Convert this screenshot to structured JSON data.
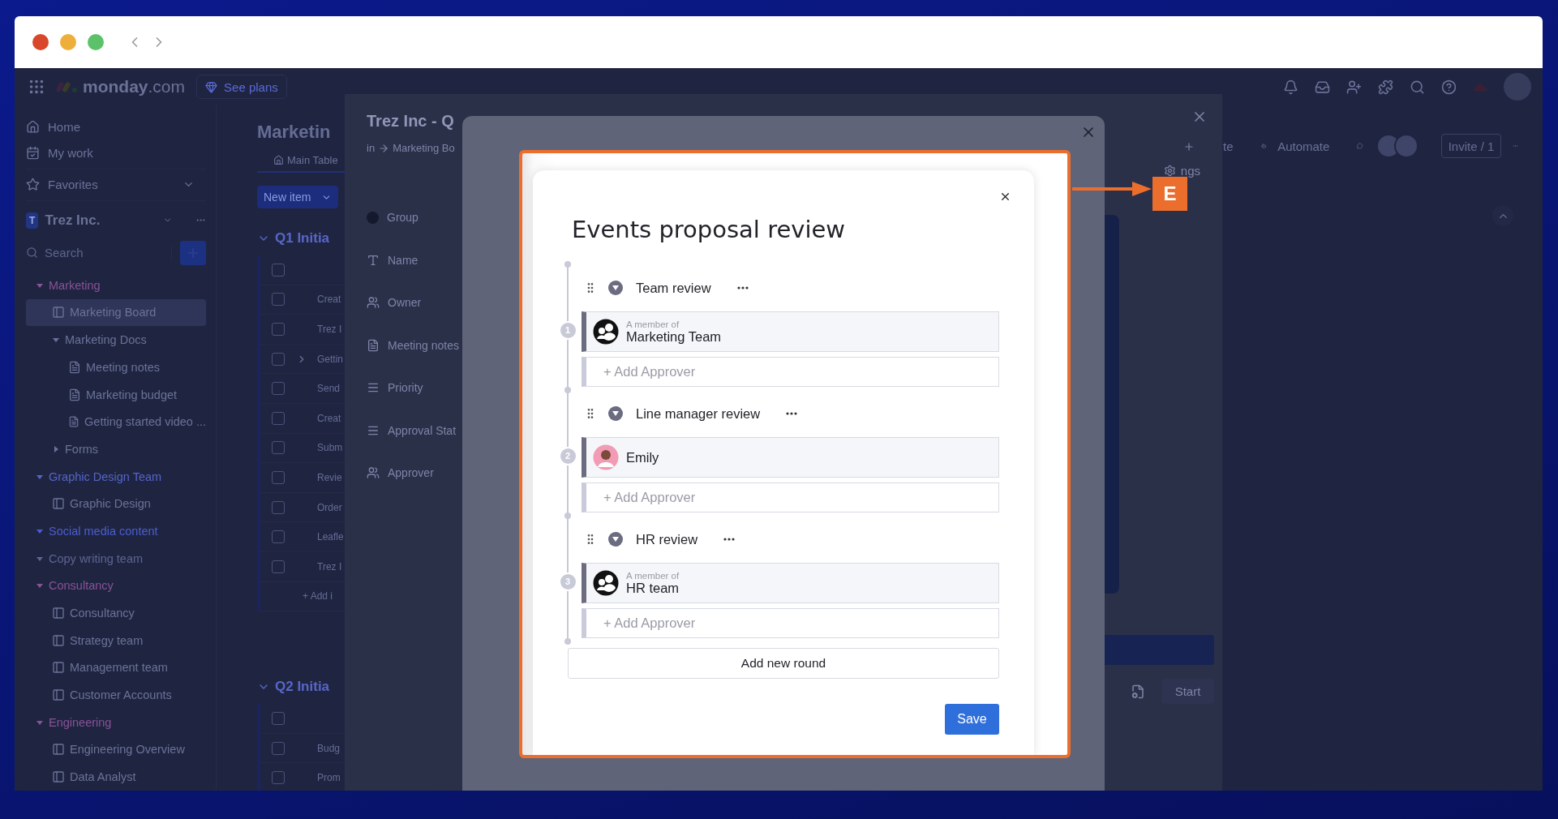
{
  "top_bar": {
    "logo": "monday",
    "logo_suffix": ".com",
    "plans_button": "See plans"
  },
  "sidebar": {
    "nav": [
      {
        "label": "Home",
        "kind": "home"
      },
      {
        "label": "My work",
        "kind": "work"
      },
      {
        "label": "Favorites",
        "kind": "favorites"
      }
    ],
    "workspace": {
      "badge": "T",
      "name": "Trez Inc."
    },
    "search": {
      "placeholder": "Search"
    },
    "tree": [
      {
        "label": "Marketing",
        "kind": "section",
        "color": "#8a5296",
        "expanded": true,
        "selected": false,
        "children": [
          {
            "label": "Marketing Board",
            "kind": "board",
            "selected": true
          },
          {
            "label": "Marketing Docs",
            "kind": "folder",
            "expanded": true,
            "selected": false,
            "children": [
              {
                "label": "Meeting notes",
                "kind": "doc",
                "selected": false
              },
              {
                "label": "Marketing budget",
                "kind": "doc",
                "selected": false
              },
              {
                "label": "Getting started video ...",
                "kind": "doc",
                "selected": false
              }
            ]
          },
          {
            "label": "Forms",
            "kind": "folder",
            "expanded": false,
            "selected": false
          }
        ]
      },
      {
        "label": "Graphic Design Team",
        "kind": "section",
        "color": "#5564c8",
        "expanded": true,
        "selected": false,
        "children": [
          {
            "label": "Graphic Design",
            "kind": "board",
            "selected": false
          }
        ]
      },
      {
        "label": "Social media content",
        "kind": "section",
        "color": "#4a5ed0",
        "expanded": true,
        "selected": false
      },
      {
        "label": "Copy writing team",
        "kind": "section",
        "color": "#5d6590",
        "expanded": true,
        "selected": false
      },
      {
        "label": "Consultancy",
        "kind": "section",
        "color": "#8a5296",
        "expanded": true,
        "selected": false,
        "children": [
          {
            "label": "Consultancy",
            "kind": "board",
            "selected": false
          },
          {
            "label": "Strategy team",
            "kind": "board",
            "selected": false
          },
          {
            "label": "Management team",
            "kind": "board",
            "selected": false
          },
          {
            "label": "Customer Accounts",
            "kind": "board",
            "selected": false
          }
        ]
      },
      {
        "label": "Engineering",
        "kind": "section",
        "color": "#8a5296",
        "expanded": true,
        "selected": false,
        "children": [
          {
            "label": "Engineering Overview",
            "kind": "board",
            "selected": false
          },
          {
            "label": "Data Analyst",
            "kind": "board",
            "selected": false
          }
        ]
      }
    ]
  },
  "board": {
    "title": "Marketin",
    "tab": "Main Table",
    "new_item": "New item",
    "groups": [
      {
        "title": "Q1 Initia",
        "expanded": true,
        "checked": false,
        "rows": [
          {
            "label": "Creat",
            "subitems": false,
            "checked": false
          },
          {
            "label": "Trez I",
            "subitems": false,
            "checked": false
          },
          {
            "label": "Gettin",
            "subitems": true,
            "checked": false
          },
          {
            "label": "Send",
            "subitems": false,
            "checked": false
          },
          {
            "label": "Creat",
            "subitems": false,
            "checked": false
          },
          {
            "label": "Subm",
            "subitems": false,
            "checked": false
          },
          {
            "label": "Revie",
            "subitems": false,
            "checked": false
          },
          {
            "label": "Order",
            "subitems": false,
            "checked": false
          },
          {
            "label": "Leafle",
            "subitems": false,
            "checked": false
          },
          {
            "label": "Trez I",
            "subitems": false,
            "checked": false
          }
        ],
        "add_row": "+ Add i"
      },
      {
        "title": "Q2 Initia",
        "expanded": true,
        "checked": false,
        "rows": [
          {
            "label": "Budg",
            "subitems": false,
            "checked": false
          },
          {
            "label": "Prom",
            "subitems": false,
            "checked": false
          }
        ]
      }
    ],
    "header_partial": "te",
    "automate": "Automate",
    "invite": "Invite / 1"
  },
  "item_panel": {
    "title": "Trez Inc - Q",
    "breadcrumb_prefix": "in",
    "breadcrumb": "Marketing Bo",
    "columns": [
      {
        "label": "Group",
        "kind": "group"
      },
      {
        "label": "Name",
        "kind": "text"
      },
      {
        "label": "Owner",
        "kind": "people"
      },
      {
        "label": "Meeting notes",
        "kind": "doc"
      },
      {
        "label": "Priority",
        "kind": "status"
      },
      {
        "label": "Approval Stat",
        "kind": "status"
      },
      {
        "label": "Approver",
        "kind": "people"
      }
    ],
    "settings_partial": "ngs",
    "start_button": "Start"
  },
  "dialog": {
    "title": "Events proposal review",
    "rounds": [
      {
        "number": "1",
        "title": "Team review",
        "expanded": true,
        "approvers": [
          {
            "kind": "team",
            "caption": "A member of",
            "name": "Marketing Team"
          }
        ],
        "add_label": "+ Add Approver"
      },
      {
        "number": "2",
        "title": "Line manager review",
        "expanded": true,
        "approvers": [
          {
            "kind": "person",
            "name": "Emily"
          }
        ],
        "add_label": "+ Add Approver"
      },
      {
        "number": "3",
        "title": "HR review",
        "expanded": true,
        "approvers": [
          {
            "kind": "team",
            "caption": "A member of",
            "name": "HR team"
          }
        ],
        "add_label": "+ Add Approver"
      }
    ],
    "add_round": "Add new round",
    "save": "Save"
  },
  "annotation": {
    "label": "E"
  }
}
